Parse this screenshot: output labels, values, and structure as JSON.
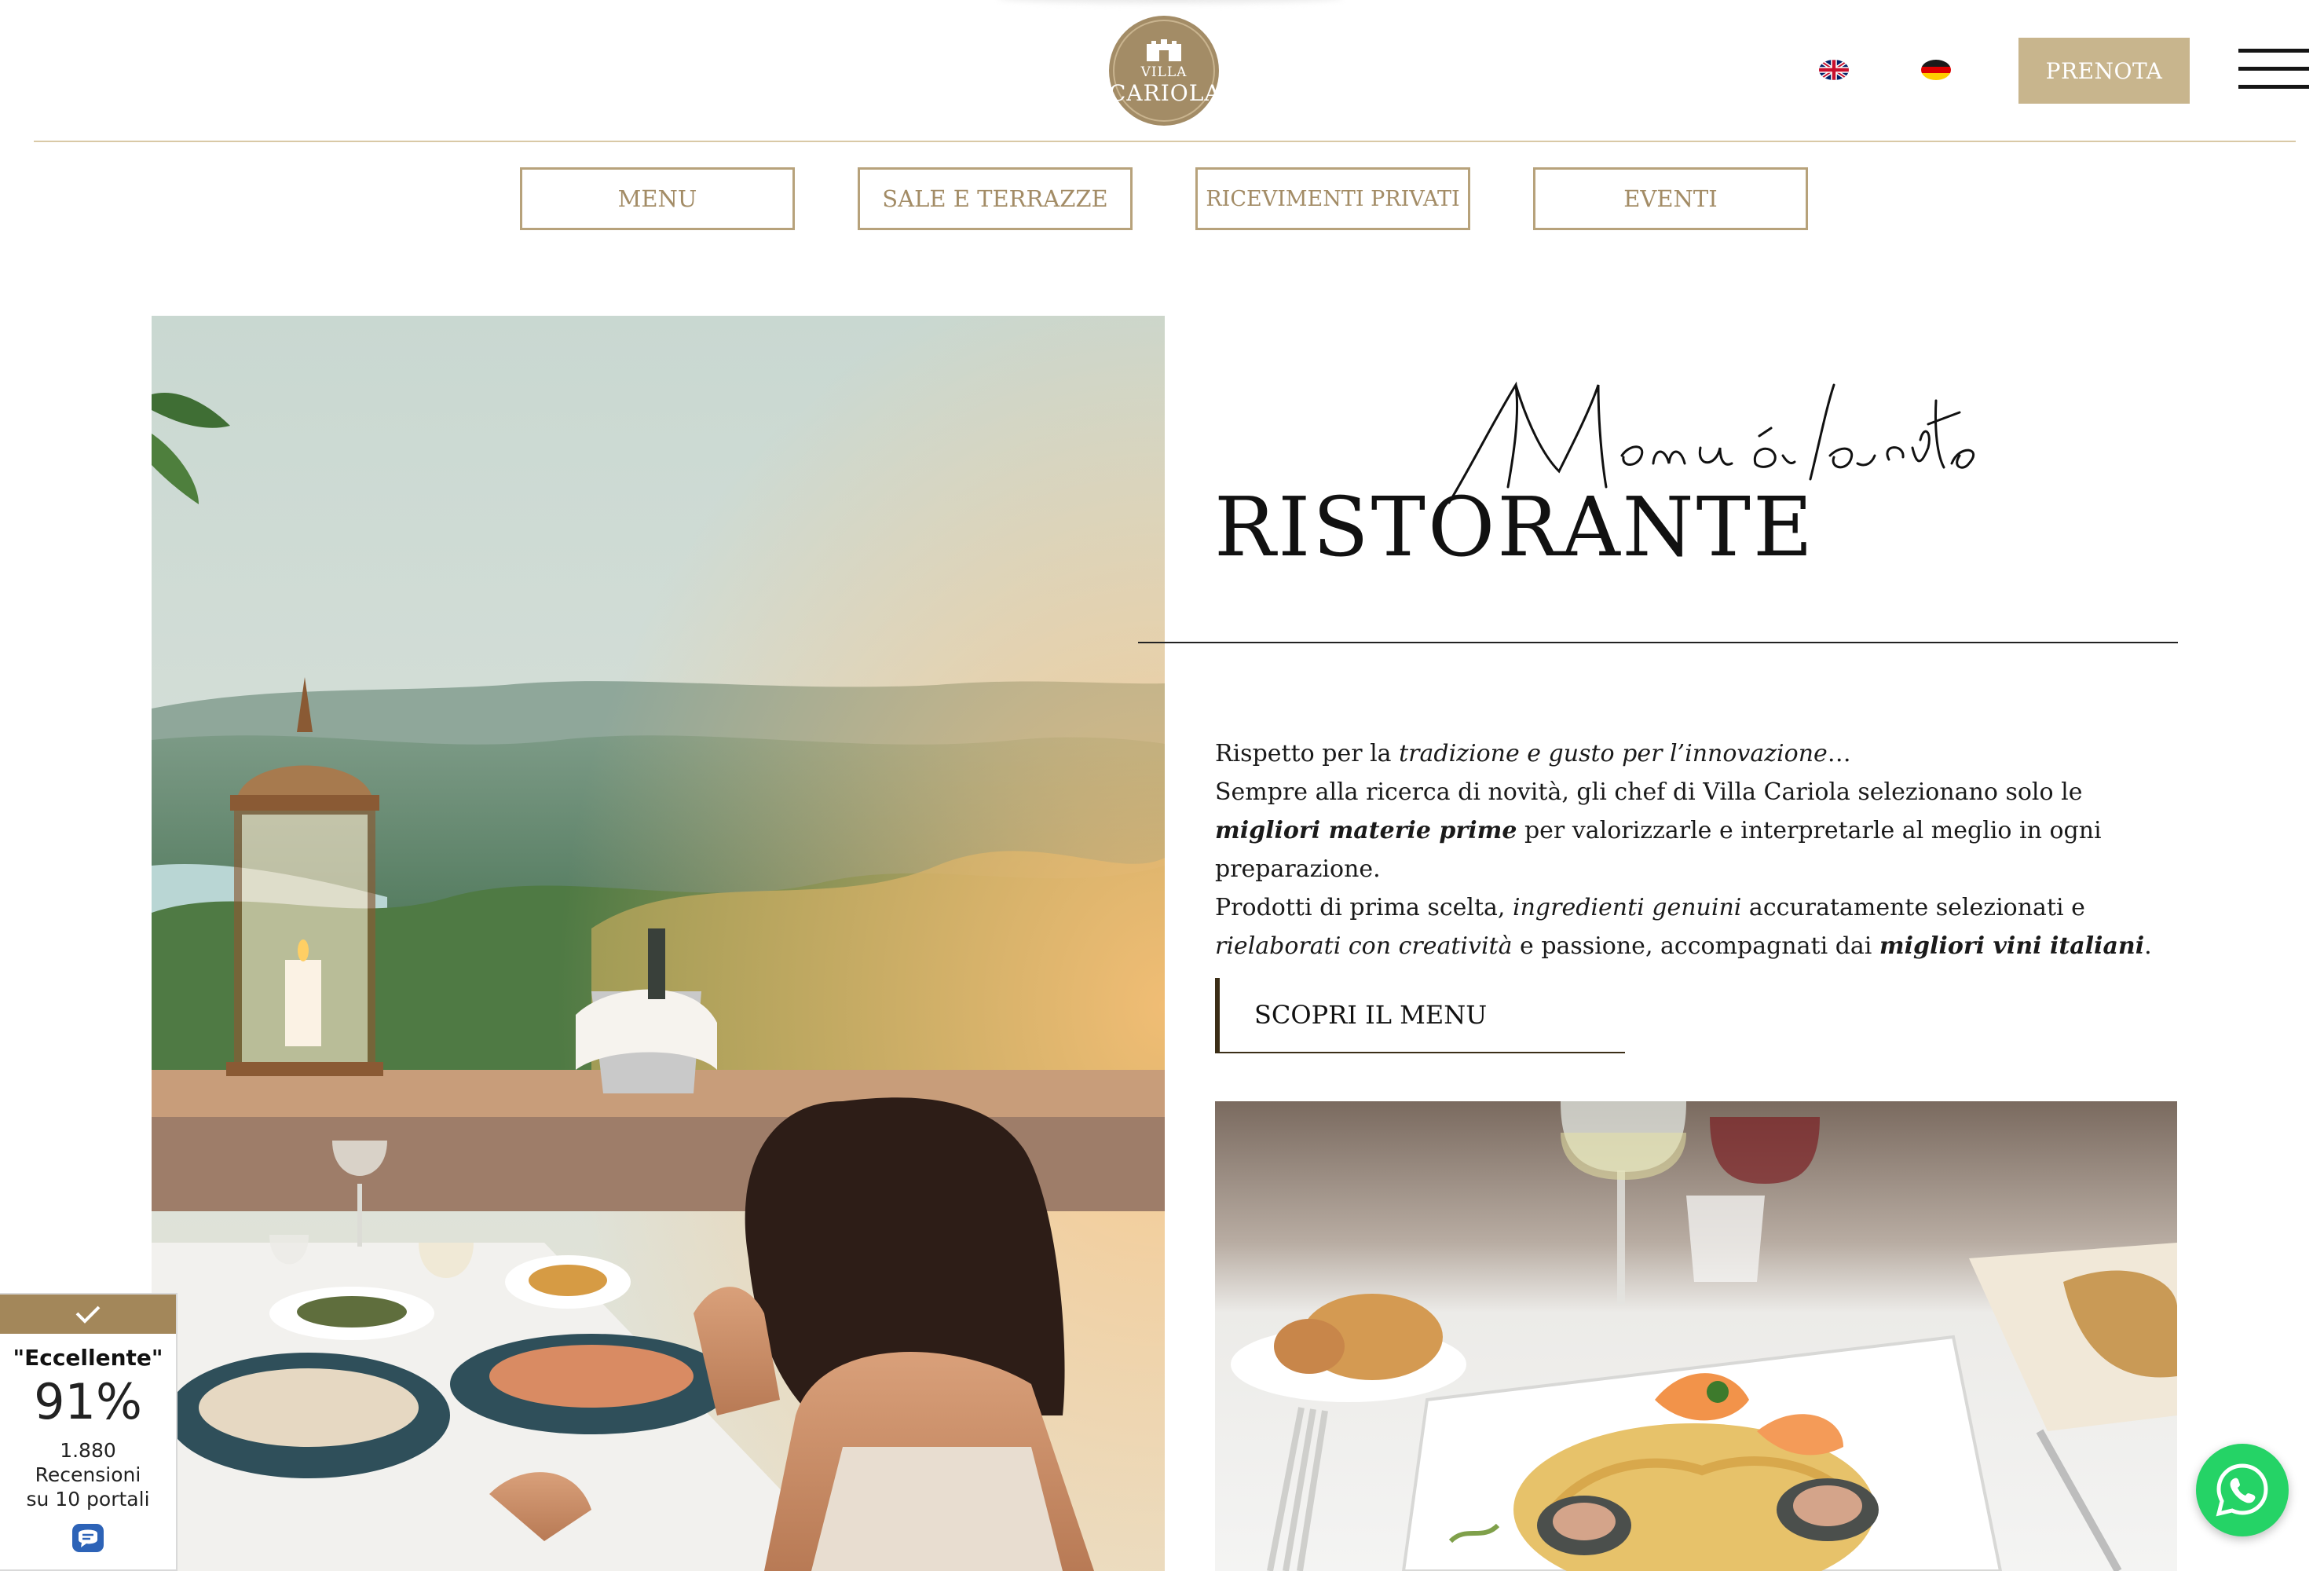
{
  "header": {
    "logo_text": {
      "line1": "VILLA",
      "line2": "CARIOLA"
    },
    "languages": [
      {
        "code": "en",
        "icon": "uk-flag-icon"
      },
      {
        "code": "de",
        "icon": "germany-flag-icon"
      }
    ],
    "cta_label": "PRENOTA",
    "menu_icon": "hamburger-menu-icon"
  },
  "subnav": {
    "items": [
      {
        "label": "MENU"
      },
      {
        "label": "SALE E TERRAZZE"
      },
      {
        "label": "RICEVIMENTI PRIVATI"
      },
      {
        "label": "EVENTI"
      }
    ]
  },
  "main": {
    "script_title": "Menu à la carte",
    "heading": "RISTORANTE",
    "paragraph": {
      "l1_a": "Rispetto per la ",
      "l1_b": "tradizione e gusto per l’innovazione",
      "l1_c": "…",
      "l2_a": "Sempre alla ricerca di novità, gli chef di Villa Cariola selezionano solo le ",
      "l2_b": "migliori materie prime",
      "l2_c": " per valorizzarle e interpretarle al meglio in ogni preparazione.",
      "l3_a": "Prodotti di prima scelta, ",
      "l3_b": "ingredienti genuini",
      "l3_c": " accuratamente selezionati e ",
      "l3_d": "rielaborati con creatività",
      "l3_e": " e passione, accompagnati dai ",
      "l3_f": "migliori vini italiani",
      "l3_g": "."
    },
    "cta_label": "SCOPRI IL MENU"
  },
  "review_badge": {
    "rating_label": "\"Eccellente\"",
    "percent": "91%",
    "count": "1.880",
    "reviews_label": "Recensioni",
    "portals_label": "su 10 portali"
  },
  "colors": {
    "gold": "#a38c66",
    "gold_light": "#c8b58d",
    "whatsapp_green": "#25d366"
  }
}
